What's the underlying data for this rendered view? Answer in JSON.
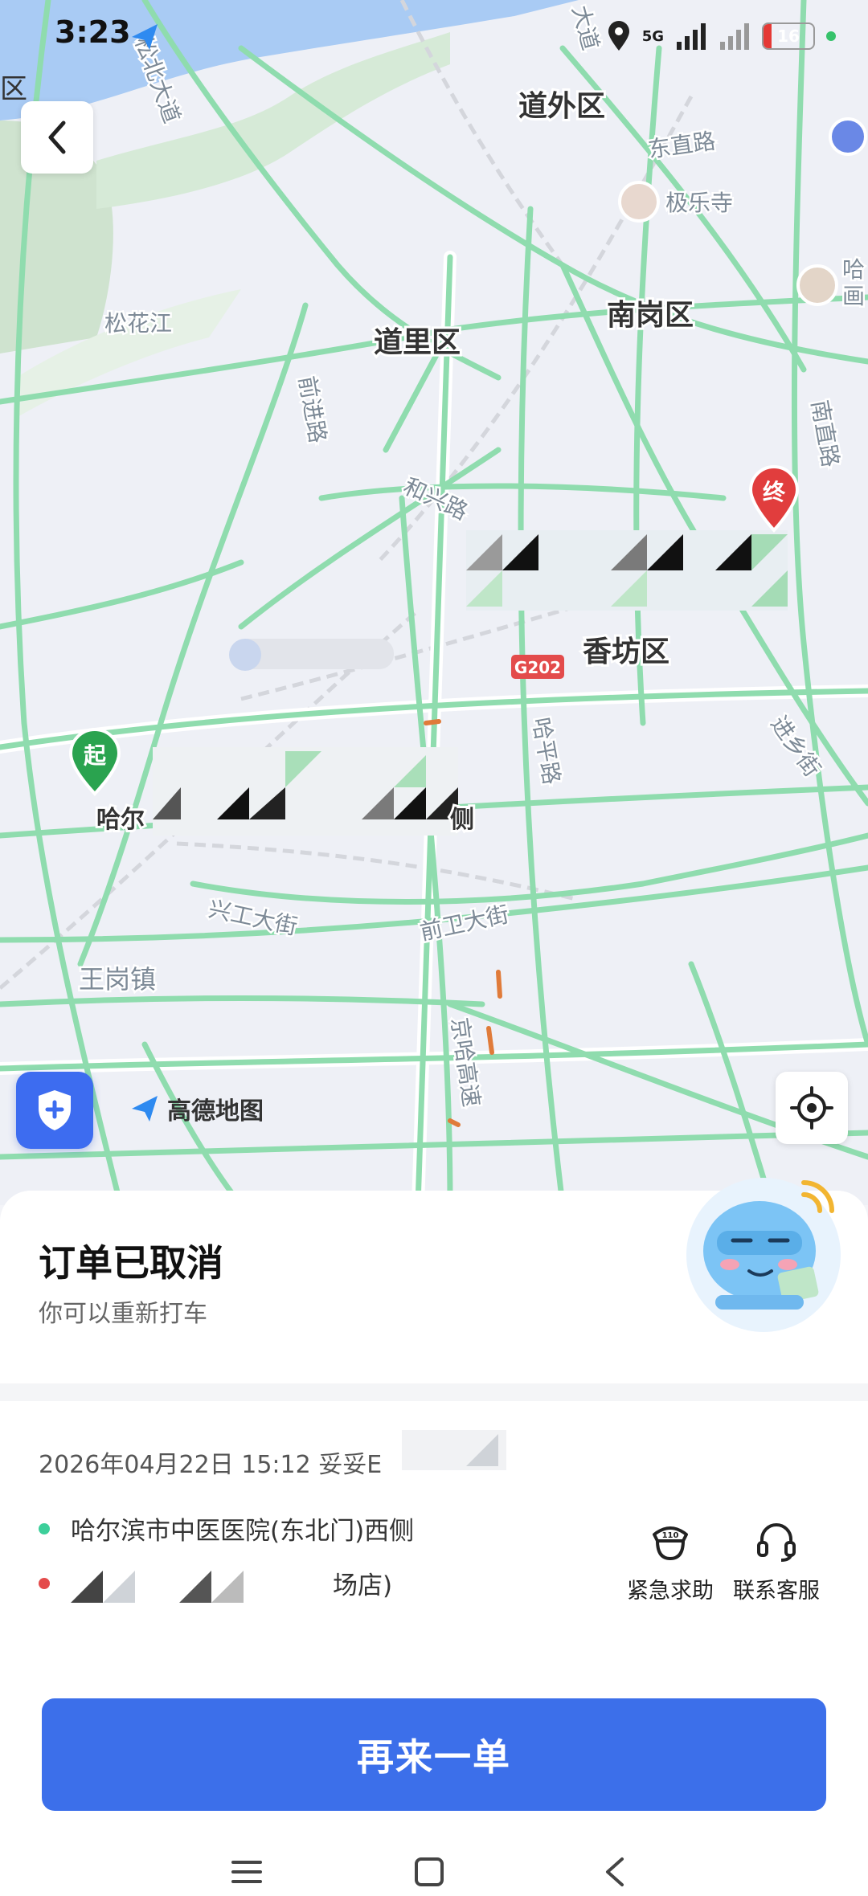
{
  "status_bar": {
    "time": "3:23",
    "network": "5G",
    "battery": "16"
  },
  "map": {
    "labels": {
      "daowai": "道外区",
      "daoli": "道里区",
      "nangang": "南岗区",
      "xiangfang": "香坊区",
      "jilesi": "极乐寺",
      "songhuajiang": "松花江",
      "dongzhi": "东直路",
      "qianjin": "前进路",
      "hexing": "和兴路",
      "haping": "哈平路",
      "nanzhi": "南直路",
      "jinxiang": "进乡街",
      "xinggong": "兴工大街",
      "qianwei": "前卫大街",
      "wanggang": "王岗镇",
      "jingha": "京哈高速",
      "songbei": "松北大道",
      "g202": "G202",
      "origin_place": "哈尔",
      "origin_place_end": "侧",
      "edge_left": "区",
      "edge_right": "哈",
      "edge_right2": "画",
      "top_road": "大道"
    },
    "start_marker": "起",
    "end_marker": "终",
    "brand": "高德地图"
  },
  "sheet": {
    "title": "订单已取消",
    "subtitle": "你可以重新打车",
    "order_meta": "2026年04月22日 15:12 妥妥E",
    "origin": "哈尔滨市中医医院(东北门)西侧",
    "destination": "场店)",
    "emergency_label": "紧急求助",
    "emergency_badge": "110",
    "service_label": "联系客服",
    "again_button": "再来一单"
  },
  "colors": {
    "accent": "#3c6fea",
    "road": "#8fdcae",
    "start": "#2aa34f",
    "end": "#e13d3d",
    "origin_dot": "#3ccf9a",
    "dest_dot": "#e44b4b"
  }
}
